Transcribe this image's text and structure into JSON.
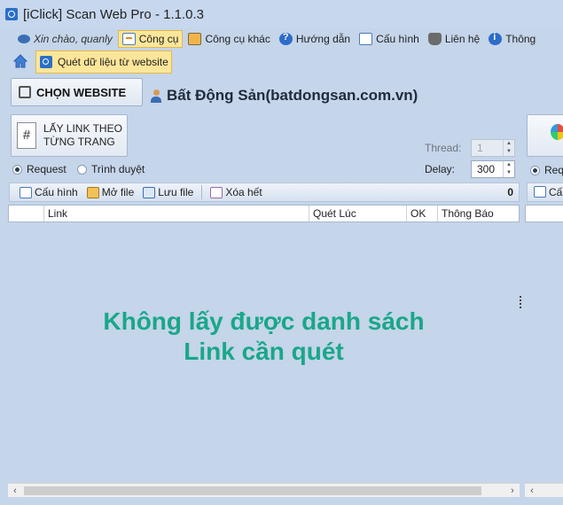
{
  "window": {
    "title": "[iClick] Scan Web Pro - 1.1.0.3"
  },
  "menu": {
    "greeting": "Xin chào, quanly",
    "items": [
      {
        "label": "Công cụ",
        "icon": "tools-icon",
        "active": true
      },
      {
        "label": "Công cụ khác",
        "icon": "other-tools-icon"
      },
      {
        "label": "Hướng dẫn",
        "icon": "help-icon"
      },
      {
        "label": "Cấu hình",
        "icon": "config-icon"
      },
      {
        "label": "Liên hệ",
        "icon": "phone-icon"
      },
      {
        "label": "Thông",
        "icon": "info-icon"
      }
    ]
  },
  "ribbon": {
    "scan_label": "Quét dữ liệu từ website"
  },
  "site": {
    "choose_label": "CHỌN WEBSITE",
    "name": "Bất Động Sản(batdongsan.com.vn)"
  },
  "controls": {
    "get_link_label": "LẤY LINK THEO TỪNG TRANG",
    "radio_request": "Request",
    "radio_browser": "Trình duyệt",
    "thread_label": "Thread:",
    "thread_value": "1",
    "delay_label": "Delay:",
    "delay_value": "300"
  },
  "toolbar": {
    "config_label": "Cấu hình",
    "open_label": "Mở file",
    "save_label": "Lưu file",
    "clear_label": "Xóa hết",
    "count": "0"
  },
  "grid": {
    "columns": [
      "",
      "Link",
      "Quét Lúc",
      "OK",
      "Thông Báo"
    ],
    "empty_line1": "Không lấy được danh sách",
    "empty_line2": "Link cần quét"
  },
  "right_panel": {
    "radio_partial": "Requ",
    "toolbar_partial": "Cấ"
  }
}
